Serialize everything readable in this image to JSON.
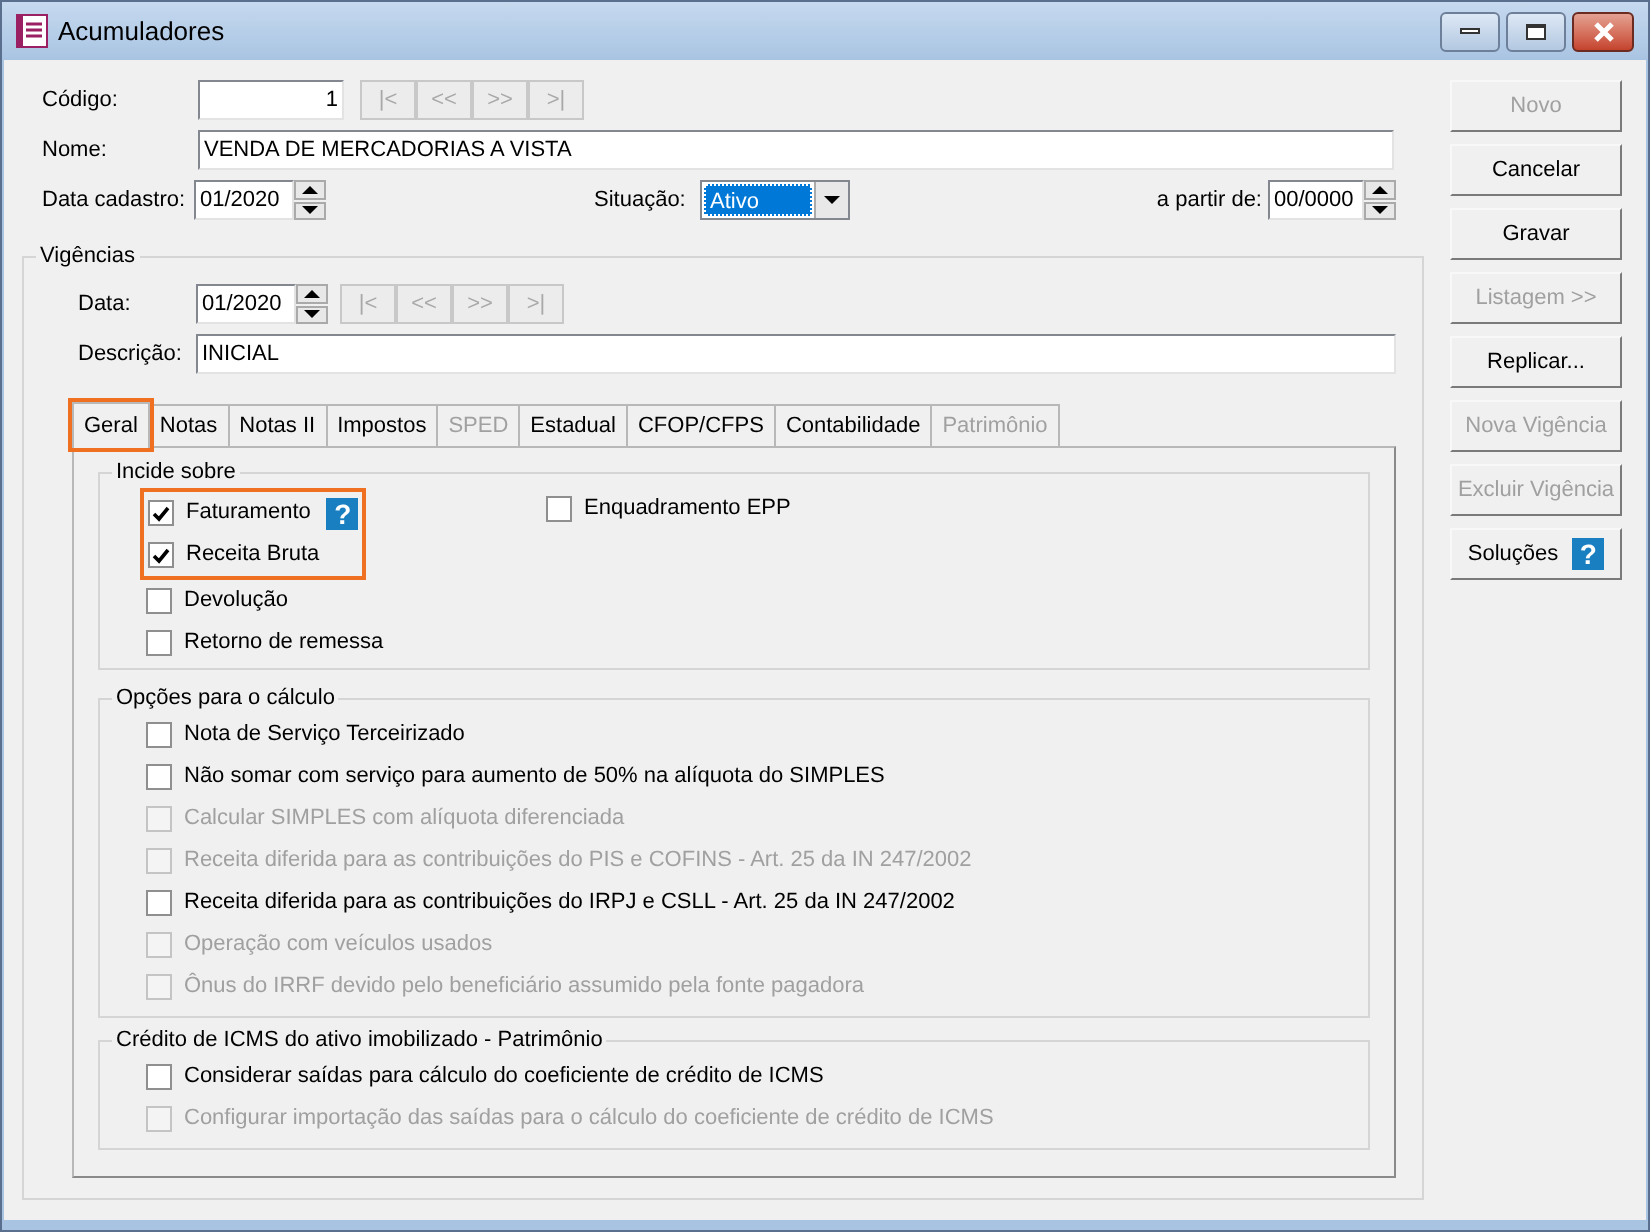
{
  "window": {
    "title": "Acumuladores"
  },
  "form": {
    "codigo": {
      "label": "Código:",
      "value": "1"
    },
    "nome": {
      "label": "Nome:",
      "value": "VENDA DE MERCADORIAS A VISTA"
    },
    "data_cadastro": {
      "label": "Data cadastro:",
      "value": "01/2020"
    },
    "situacao": {
      "label": "Situação:",
      "value": "Ativo"
    },
    "a_partir_de": {
      "label": "a partir de:",
      "value": "00/0000"
    }
  },
  "record_nav": [
    {
      "label": "|<",
      "disabled": true
    },
    {
      "label": "<<",
      "disabled": true
    },
    {
      "label": ">>",
      "disabled": true
    },
    {
      "label": ">|",
      "disabled": true
    }
  ],
  "vigencias": {
    "title": "Vigências",
    "data": {
      "label": "Data:",
      "value": "01/2020"
    },
    "descricao": {
      "label": "Descrição:",
      "value": "INICIAL"
    },
    "nav": [
      {
        "label": "|<",
        "disabled": true
      },
      {
        "label": "<<",
        "disabled": true
      },
      {
        "label": ">>",
        "disabled": true
      },
      {
        "label": ">|",
        "disabled": true
      }
    ]
  },
  "tabs": [
    {
      "label": "Geral",
      "selected": true,
      "disabled": false,
      "highlighted": true
    },
    {
      "label": "Notas",
      "selected": false,
      "disabled": false,
      "highlighted": false
    },
    {
      "label": "Notas II",
      "selected": false,
      "disabled": false,
      "highlighted": false
    },
    {
      "label": "Impostos",
      "selected": false,
      "disabled": false,
      "highlighted": false
    },
    {
      "label": "SPED",
      "selected": false,
      "disabled": true,
      "highlighted": false
    },
    {
      "label": "Estadual",
      "selected": false,
      "disabled": false,
      "highlighted": false
    },
    {
      "label": "CFOP/CFPS",
      "selected": false,
      "disabled": false,
      "highlighted": false
    },
    {
      "label": "Contabilidade",
      "selected": false,
      "disabled": false,
      "highlighted": false
    },
    {
      "label": "Patrimônio",
      "selected": false,
      "disabled": true,
      "highlighted": false
    }
  ],
  "groups": [
    {
      "title": "Incide sobre",
      "items": [
        {
          "label": "Faturamento",
          "checked": true,
          "disabled": false,
          "highlighted": true,
          "help": "?"
        },
        {
          "label": "Receita Bruta",
          "checked": true,
          "disabled": false,
          "highlighted": true
        },
        {
          "label": "Devolução",
          "checked": false,
          "disabled": false,
          "highlighted": false
        },
        {
          "label": "Retorno de remessa",
          "checked": false,
          "disabled": false,
          "highlighted": false
        }
      ],
      "column_2": [
        {
          "label": "Enquadramento EPP",
          "checked": false,
          "disabled": false,
          "highlighted": false
        }
      ]
    },
    {
      "title": "Opções para o cálculo",
      "items": [
        {
          "label": "Nota de Serviço Terceirizado",
          "checked": false,
          "disabled": false,
          "highlighted": false
        },
        {
          "label": "Não somar com serviço para aumento de 50% na alíquota do SIMPLES",
          "checked": false,
          "disabled": false,
          "highlighted": false
        },
        {
          "label": "Calcular SIMPLES com alíquota diferenciada",
          "checked": false,
          "disabled": true,
          "highlighted": false
        },
        {
          "label": "Receita diferida para as contribuições do PIS e COFINS -  Art. 25 da IN 247/2002",
          "checked": false,
          "disabled": true,
          "highlighted": false
        },
        {
          "label": "Receita diferida para as contribuições do IRPJ e CSLL - Art. 25 da IN 247/2002",
          "checked": false,
          "disabled": false,
          "highlighted": false
        },
        {
          "label": "Operação com veículos usados",
          "checked": false,
          "disabled": true,
          "highlighted": false
        },
        {
          "label": "Ônus do IRRF devido pelo beneficiário assumido pela fonte pagadora",
          "checked": false,
          "disabled": true,
          "highlighted": false
        }
      ]
    },
    {
      "title": "Crédito de ICMS do ativo imobilizado - Patrimônio",
      "items": [
        {
          "label": "Considerar saídas para cálculo do coeficiente de crédito de ICMS",
          "checked": false,
          "disabled": false,
          "highlighted": false
        },
        {
          "label": "Configurar importação das saídas para o cálculo do coeficiente de crédito de ICMS",
          "checked": false,
          "disabled": true,
          "highlighted": false
        }
      ]
    }
  ],
  "side_buttons": [
    {
      "label": "Novo",
      "disabled": true
    },
    {
      "label": "Cancelar",
      "disabled": false
    },
    {
      "label": "Gravar",
      "disabled": false
    },
    {
      "label": "Listagem >>",
      "disabled": true
    },
    {
      "label": "Replicar...",
      "disabled": false
    },
    {
      "label": "Nova Vigência",
      "disabled": true
    },
    {
      "label": "Excluir Vigência",
      "disabled": true
    },
    {
      "label": "Soluções",
      "disabled": false,
      "help": "?"
    }
  ]
}
